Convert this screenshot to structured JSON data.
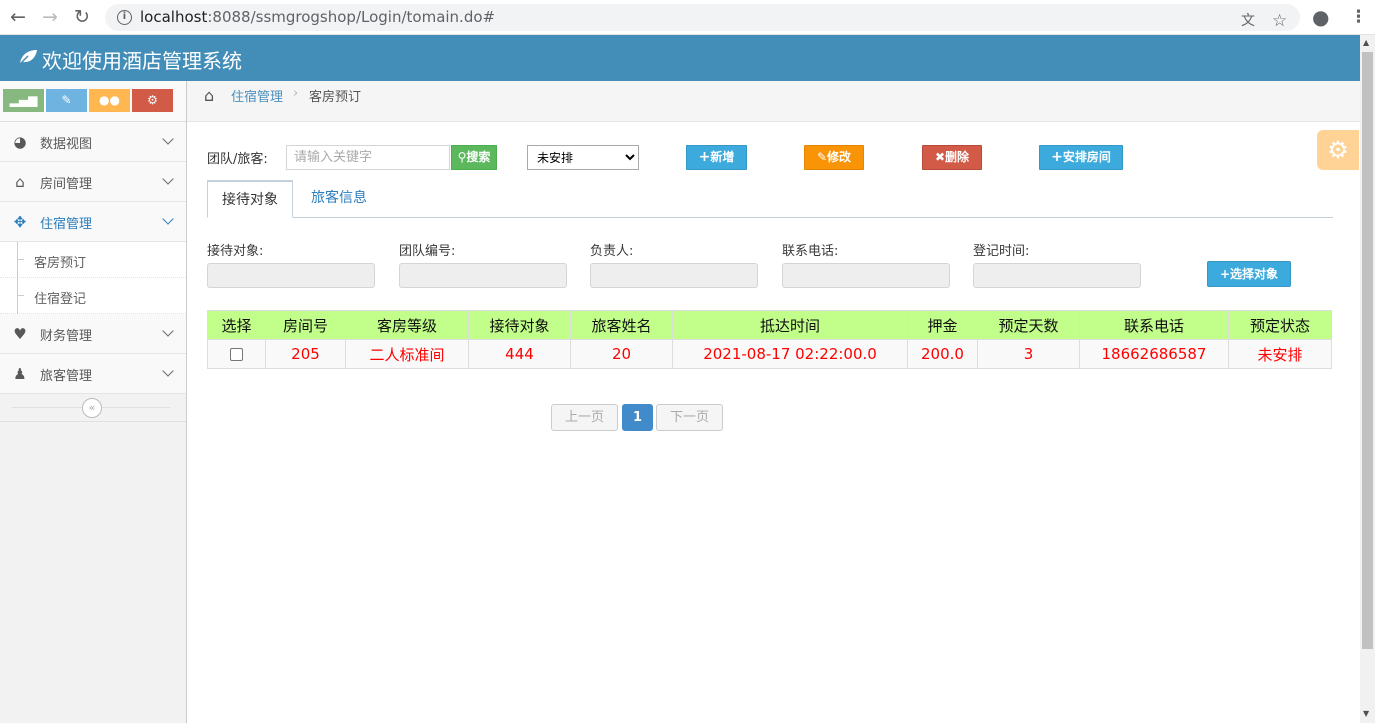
{
  "browser": {
    "url_host": "localhost",
    "url_rest": ":8088/ssmgrogshop/Login/tomain.do#"
  },
  "app": {
    "title": "欢迎使用酒店管理系统",
    "brand_color": "#438eb9"
  },
  "sidebar": {
    "shortcuts": [
      {
        "icon": "signal-icon",
        "color": "#87b87f"
      },
      {
        "icon": "pencil-icon",
        "color": "#6fb3e0"
      },
      {
        "icon": "users-icon",
        "color": "#ffb752"
      },
      {
        "icon": "cogs-icon",
        "color": "#d15b47"
      }
    ],
    "items": [
      {
        "label": "数据视图",
        "icon": "dashboard-icon"
      },
      {
        "label": "房间管理",
        "icon": "home-icon"
      },
      {
        "label": "住宿管理",
        "icon": "arrows-icon",
        "active": true,
        "children": [
          {
            "label": "客房预订"
          },
          {
            "label": "住宿登记"
          }
        ]
      },
      {
        "label": "财务管理",
        "icon": "heart-icon"
      },
      {
        "label": "旅客管理",
        "icon": "user-icon"
      }
    ]
  },
  "breadcrumb": {
    "parent": "住宿管理",
    "current": "客房预订"
  },
  "toolbar": {
    "search_label": "团队/旅客:",
    "search_placeholder": "请输入关键字",
    "search_value": "",
    "search_button": "搜索",
    "status_selected": "未安排",
    "add_button": "新增",
    "edit_button": "修改",
    "delete_button": "删除",
    "arrange_button": "安排房间"
  },
  "tabs": [
    {
      "label": "接待对象",
      "active": true
    },
    {
      "label": "旅客信息",
      "active": false
    }
  ],
  "form": {
    "labels": [
      "接待对象:",
      "团队编号:",
      "负责人:",
      "联系电话:",
      "登记时间:"
    ],
    "select_button": "选择对象"
  },
  "table": {
    "headers": [
      "选择",
      "房间号",
      "客房等级",
      "接待对象",
      "旅客姓名",
      "抵达时间",
      "押金",
      "预定天数",
      "联系电话",
      "预定状态"
    ],
    "rows": [
      [
        "",
        "205",
        "二人标准间",
        "444",
        "20",
        "2021-08-17 02:22:00.0",
        "200.0",
        "3",
        "18662686587",
        "未安排"
      ]
    ]
  },
  "pagination": {
    "prev": "上一页",
    "current": "1",
    "next": "下一页"
  }
}
